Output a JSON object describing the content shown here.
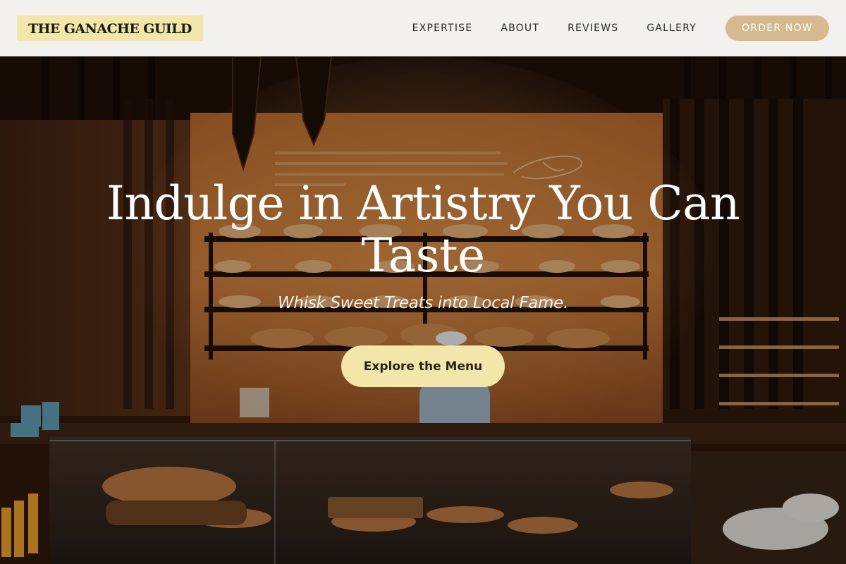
{
  "brand": {
    "name": "THE GANACHE GUILD"
  },
  "nav": {
    "links": [
      "EXPERTISE",
      "ABOUT",
      "REVIEWS",
      "GALLERY"
    ],
    "order_label": "ORDER NOW"
  },
  "hero": {
    "title": "Indulge in Artistry You Can Taste",
    "subtitle": "Whisk Sweet Treats into Local Fame.",
    "cta_label": "Explore the Menu"
  },
  "colors": {
    "nav_bg": "#f3f1ee",
    "logo_bg": "#f3e6aa",
    "accent_button": "#d6b98e",
    "cta_bg": "#f3e6aa"
  }
}
